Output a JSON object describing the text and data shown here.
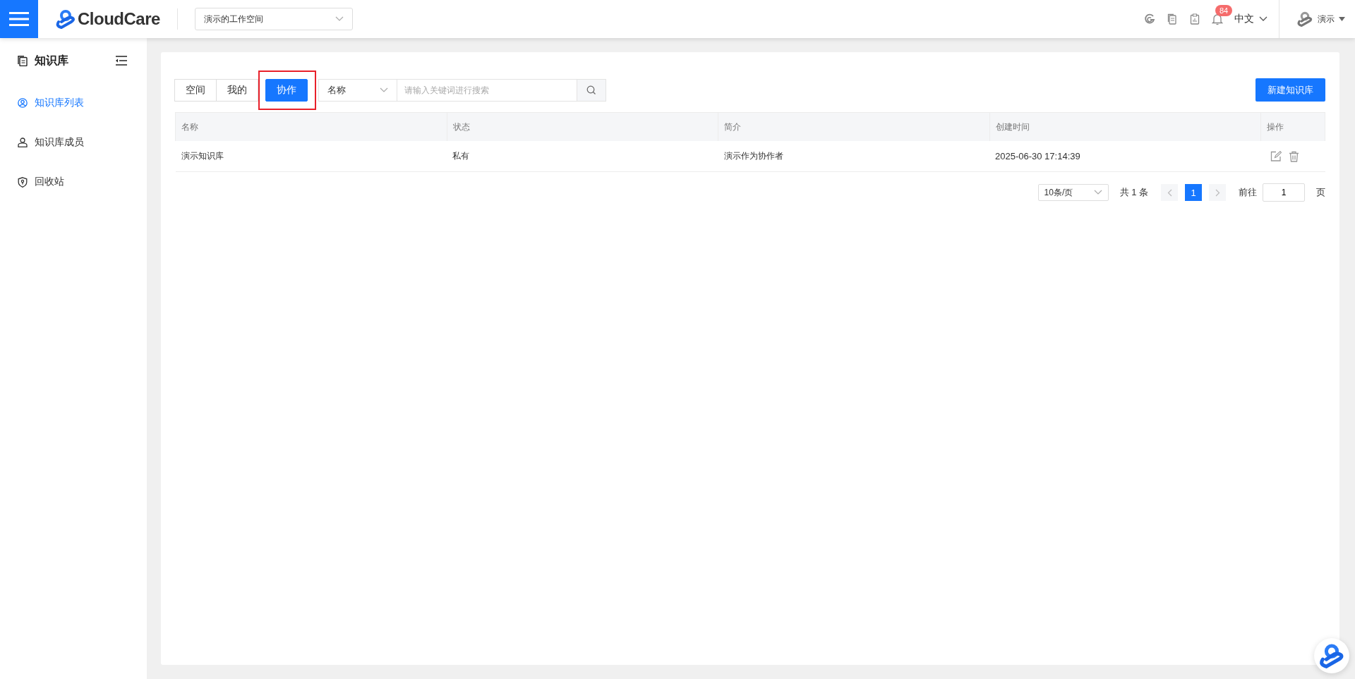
{
  "header": {
    "brand": "CloudCare",
    "workspace": "演示的工作空间",
    "notification_count": "84",
    "language": "中文",
    "user": "演示"
  },
  "sidebar": {
    "title": "知识库",
    "items": [
      {
        "label": "知识库列表",
        "selected": true,
        "kind": "list"
      },
      {
        "label": "知识库成员",
        "selected": false,
        "kind": "members"
      },
      {
        "label": "回收站",
        "selected": false,
        "kind": "recycle"
      }
    ]
  },
  "tabs": [
    {
      "label": "空间",
      "selected": false,
      "highlighted": false
    },
    {
      "label": "我的",
      "selected": false,
      "highlighted": false
    },
    {
      "label": "协作",
      "selected": true,
      "highlighted": true
    }
  ],
  "search": {
    "field": "名称",
    "placeholder": "请输入关键词进行搜索"
  },
  "new_button": "新建知识库",
  "table": {
    "columns": [
      "名称",
      "状态",
      "简介",
      "创建时间",
      "操作"
    ],
    "rows": [
      {
        "cells": [
          "演示知识库",
          "私有",
          "演示作为协作者",
          "2025-06-30 17:14:39"
        ]
      }
    ]
  },
  "pagination": {
    "page_size": "10条/页",
    "total": "共 1 条",
    "pages": [
      {
        "label": "1",
        "selected": true
      }
    ],
    "goto_label": "前往",
    "goto_value": "1",
    "page_unit": "页"
  }
}
